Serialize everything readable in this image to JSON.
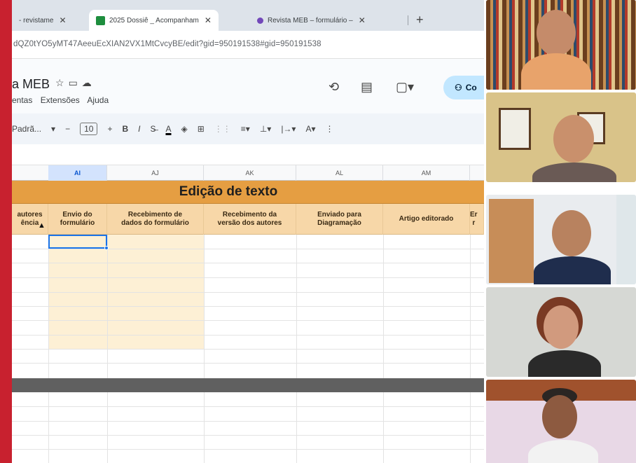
{
  "browser": {
    "tabs": [
      {
        "title": "- revistame",
        "active": false
      },
      {
        "title": "2025 Dossiê _ Acompanham",
        "active": true
      },
      {
        "title": "Revista MEB – formulário –",
        "active": false
      }
    ],
    "url": "dQZ0tYO5yMT47AeeuEcXIAN2VX1MtCvcyBE/edit?gid=950191538#gid=950191538"
  },
  "sheets": {
    "doc_title": "a MEB",
    "menus": [
      "entas",
      "Extensões",
      "Ajuda"
    ],
    "share_label": "Co",
    "toolbar": {
      "font_name": "Padrã...",
      "font_size": "10",
      "minus": "−",
      "plus": "+",
      "bold": "B",
      "italic": "I",
      "strike": "S̶",
      "text_color": "A"
    },
    "columns": [
      "AI",
      "AJ",
      "AK",
      "AL",
      "AM"
    ],
    "section_banner": "Edição de texto",
    "headers": [
      "autores\nência",
      "Envio do\nformulário",
      "Recebimento de\ndados do formulário",
      "Recebimento da\nversão dos autores",
      "Enviado para\nDiagramação",
      "Artigo editorado",
      "Er\nr"
    ]
  },
  "colors": {
    "accent_left_bar": "#c8212f",
    "banner": "#e59e42",
    "header_row": "#f7d7a8",
    "highlight_cells": "#fdf0d5",
    "selection": "#1a73e8"
  },
  "video_participants": [
    "participant-1",
    "participant-2",
    "participant-3",
    "participant-4",
    "participant-5"
  ]
}
